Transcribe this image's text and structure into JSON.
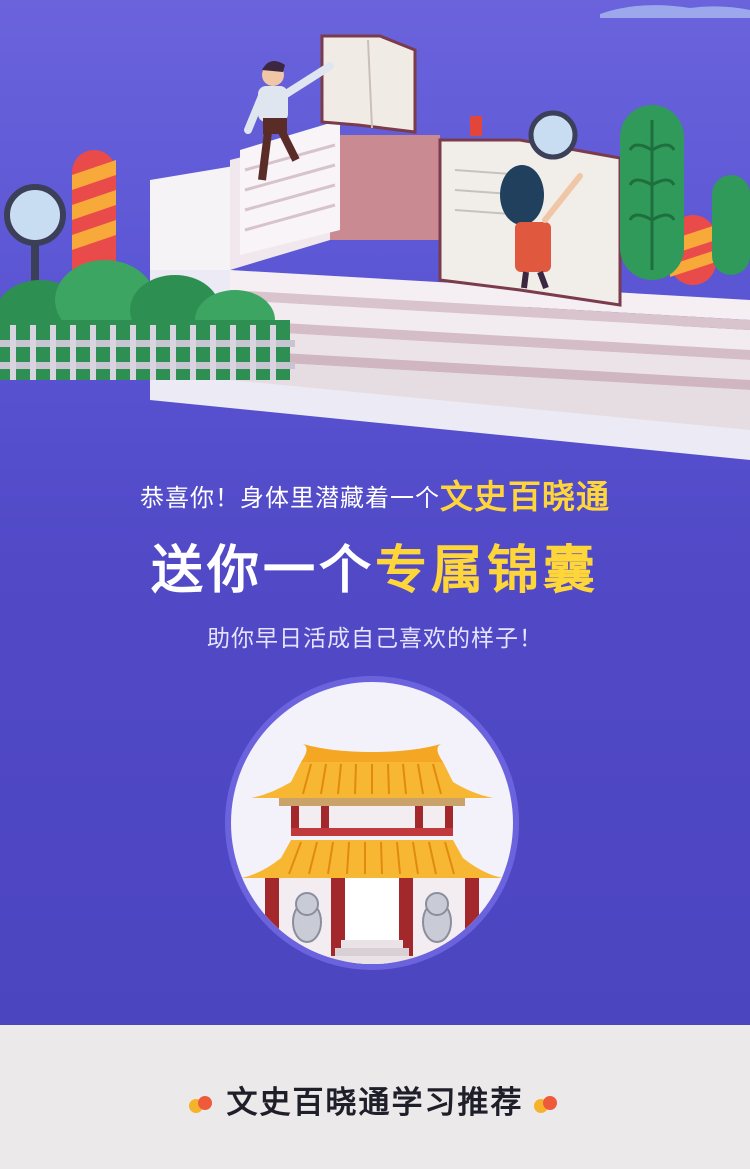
{
  "hero": {
    "congrats_prefix": "恭喜你！身体里潜藏着一个",
    "congrats_highlight": "文史百晓通",
    "gift_prefix": "送你一个",
    "gift_highlight": "专属锦囊",
    "subtitle": "助你早日活成自己喜欢的样子！",
    "highlight_color": "#ffd63a",
    "background_color": "#5149c6"
  },
  "footer": {
    "title": "文史百晓通学习推荐",
    "dot_colors": [
      "#f5b32b",
      "#ef5a3a"
    ]
  }
}
